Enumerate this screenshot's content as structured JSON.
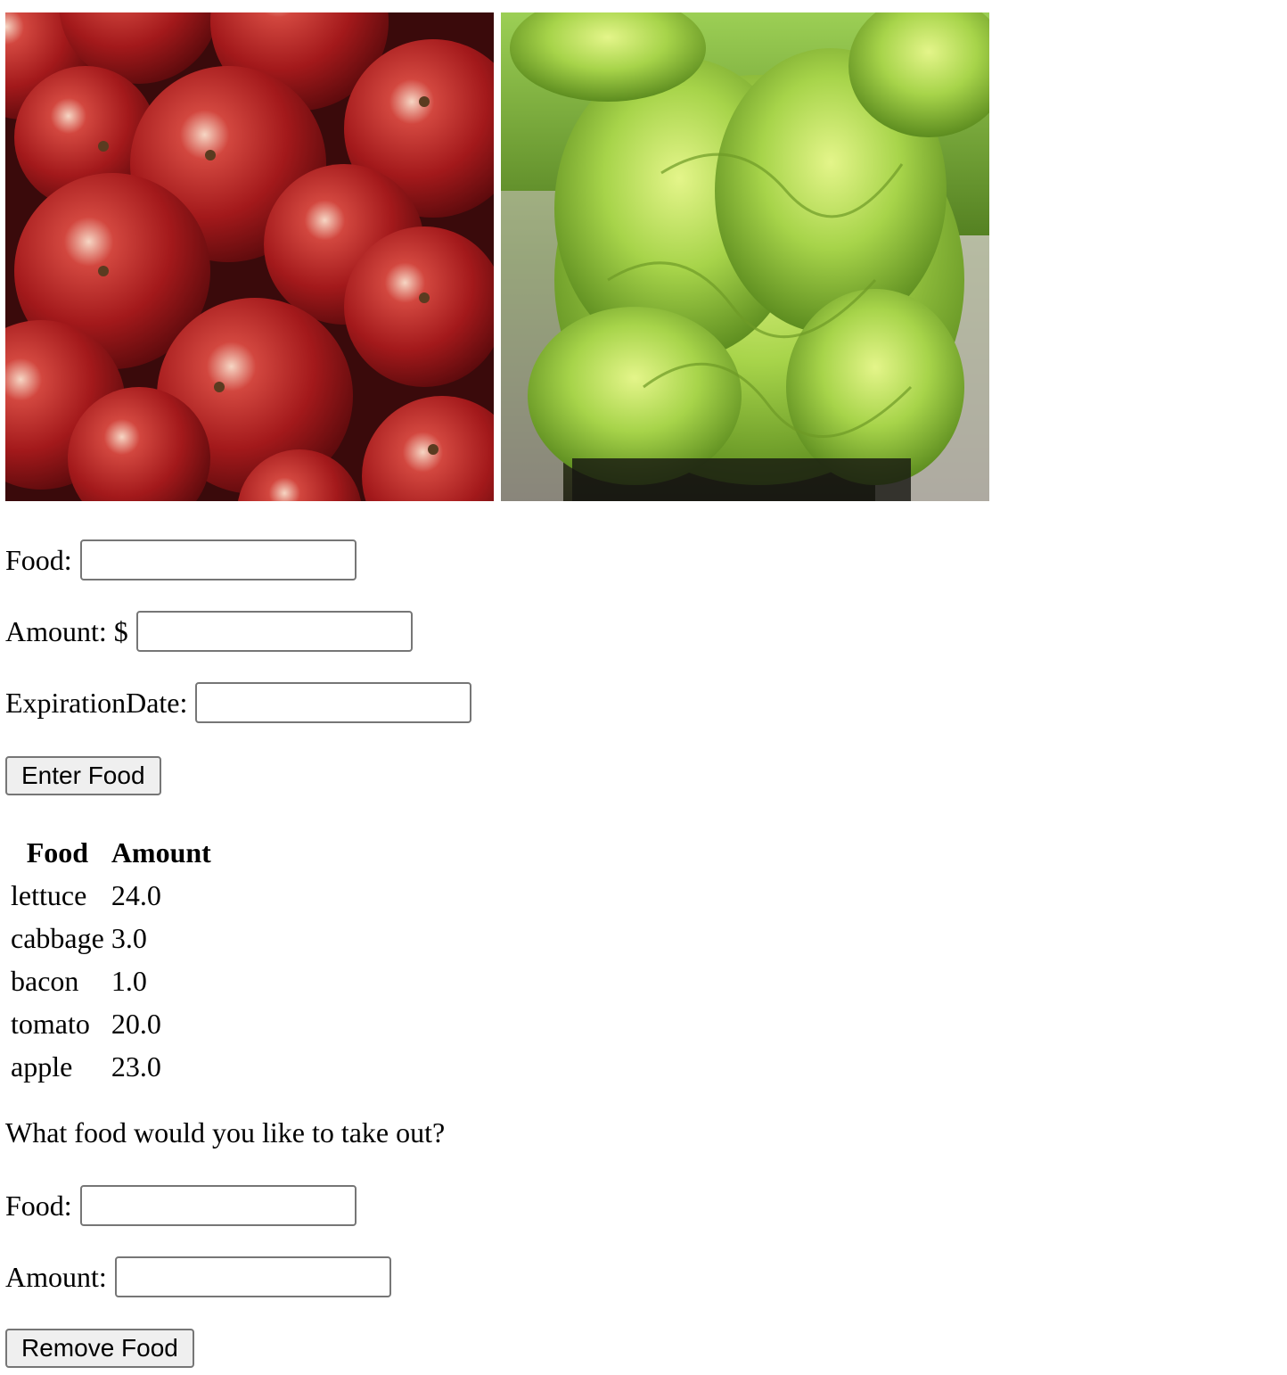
{
  "images": [
    {
      "name": "apples-image",
      "icon": "apples-photo"
    },
    {
      "name": "lettuce-image",
      "icon": "lettuce-photo"
    }
  ],
  "add_form": {
    "food_label": "Food:",
    "food_value": "",
    "amount_label": "Amount: $",
    "amount_value": "",
    "expiration_label": "ExpirationDate:",
    "expiration_value": "",
    "submit_label": "Enter Food"
  },
  "table": {
    "headers": [
      "Food",
      "Amount"
    ],
    "rows": [
      [
        "lettuce",
        "24.0"
      ],
      [
        "cabbage",
        "3.0"
      ],
      [
        "bacon",
        "1.0"
      ],
      [
        "tomato",
        "20.0"
      ],
      [
        "apple",
        "23.0"
      ]
    ]
  },
  "remove_form": {
    "question": "What food would you like to take out?",
    "food_label": "Food:",
    "food_value": "",
    "amount_label": "Amount:",
    "amount_value": "",
    "submit_label": "Remove Food"
  },
  "colors": {
    "apple_red": "#9e1b1b",
    "lettuce_green": "#8cc63f",
    "button_bg": "#efefef",
    "input_border": "#767676"
  }
}
